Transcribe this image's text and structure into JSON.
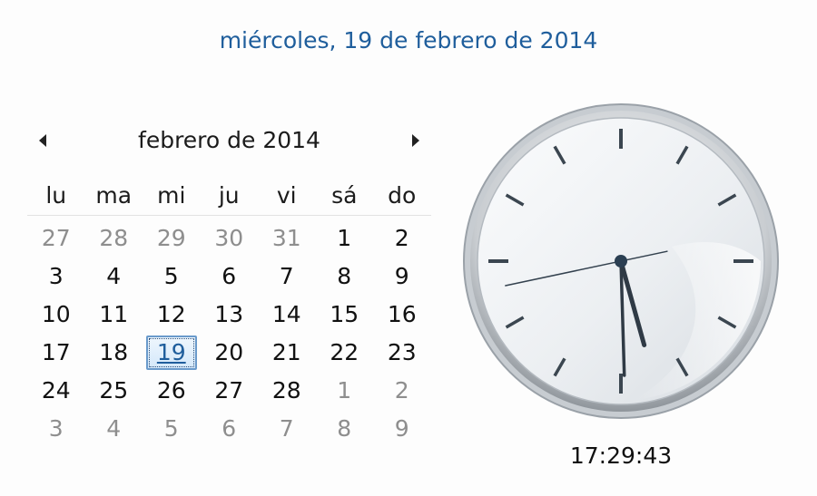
{
  "header": {
    "long_date": "miércoles, 19 de febrero de 2014"
  },
  "calendar": {
    "month_title": "febrero de 2014",
    "prev_icon": "triangle-left-icon",
    "next_icon": "triangle-right-icon",
    "weekdays": [
      "lu",
      "ma",
      "mi",
      "ju",
      "vi",
      "sá",
      "do"
    ],
    "weeks": [
      [
        {
          "d": "27",
          "other": true
        },
        {
          "d": "28",
          "other": true
        },
        {
          "d": "29",
          "other": true
        },
        {
          "d": "30",
          "other": true
        },
        {
          "d": "31",
          "other": true
        },
        {
          "d": "1",
          "other": false
        },
        {
          "d": "2",
          "other": false
        }
      ],
      [
        {
          "d": "3",
          "other": false
        },
        {
          "d": "4",
          "other": false
        },
        {
          "d": "5",
          "other": false
        },
        {
          "d": "6",
          "other": false
        },
        {
          "d": "7",
          "other": false
        },
        {
          "d": "8",
          "other": false
        },
        {
          "d": "9",
          "other": false
        }
      ],
      [
        {
          "d": "10",
          "other": false
        },
        {
          "d": "11",
          "other": false
        },
        {
          "d": "12",
          "other": false
        },
        {
          "d": "13",
          "other": false
        },
        {
          "d": "14",
          "other": false
        },
        {
          "d": "15",
          "other": false
        },
        {
          "d": "16",
          "other": false
        }
      ],
      [
        {
          "d": "17",
          "other": false
        },
        {
          "d": "18",
          "other": false
        },
        {
          "d": "19",
          "other": false,
          "today": true
        },
        {
          "d": "20",
          "other": false
        },
        {
          "d": "21",
          "other": false
        },
        {
          "d": "22",
          "other": false
        },
        {
          "d": "23",
          "other": false
        }
      ],
      [
        {
          "d": "24",
          "other": false
        },
        {
          "d": "25",
          "other": false
        },
        {
          "d": "26",
          "other": false
        },
        {
          "d": "27",
          "other": false
        },
        {
          "d": "28",
          "other": false
        },
        {
          "d": "1",
          "other": true
        },
        {
          "d": "2",
          "other": true
        }
      ],
      [
        {
          "d": "3",
          "other": true
        },
        {
          "d": "4",
          "other": true
        },
        {
          "d": "5",
          "other": true
        },
        {
          "d": "6",
          "other": true
        },
        {
          "d": "7",
          "other": true
        },
        {
          "d": "8",
          "other": true
        },
        {
          "d": "9",
          "other": true
        }
      ]
    ]
  },
  "clock": {
    "time_text": "17:29:43",
    "hours": 17,
    "minutes": 29,
    "seconds": 43
  },
  "colors": {
    "accent": "#1f5e9c",
    "other_month": "#8e8e8e",
    "today_border": "#6a9acb"
  }
}
